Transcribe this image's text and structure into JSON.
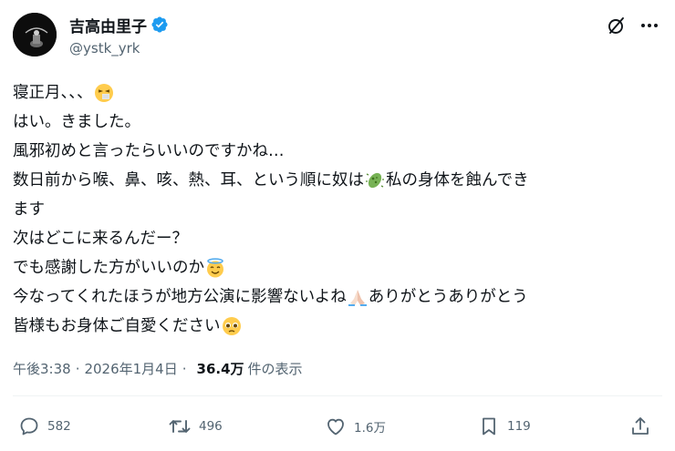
{
  "author": {
    "display_name": "吉高由里子",
    "handle": "@ystk_yrk"
  },
  "post": {
    "lines": [
      {
        "text": "寝正月、、、",
        "emoji_after": "sneezing-face"
      },
      {
        "text": "はい。きました。"
      },
      {
        "text": "風邪初めと言ったらいいのですかね…"
      },
      {
        "text_before": "数日前から喉、鼻、咳、熱、耳、という順に奴は",
        "emoji": "microbe",
        "text_after": "私の身体を蝕んでき"
      },
      {
        "text": "ます"
      },
      {
        "text": "次はどこに来るんだー？"
      },
      {
        "text": "でも感謝した方がいいのか",
        "emoji_after": "smiling-face-with-halo"
      },
      {
        "text_before": "今なってくれたほうが地方公演に影響ないよね",
        "emoji": "folded-hands",
        "text_after": "ありがとうありがとう"
      },
      {
        "text": "皆様もお身体ご自愛ください",
        "emoji_after": "pleading-face"
      }
    ]
  },
  "meta": {
    "time": "午後3:38",
    "separator": "·",
    "date": "2026年1月4日",
    "views_count": "36.4万",
    "views_label": "件の表示"
  },
  "actions": {
    "replies": "582",
    "reposts": "496",
    "likes": "1.6万",
    "bookmarks": "119"
  },
  "colors": {
    "verified": "#1d9bf0",
    "secondary_text": "#536471",
    "primary_text": "#0f1419"
  }
}
